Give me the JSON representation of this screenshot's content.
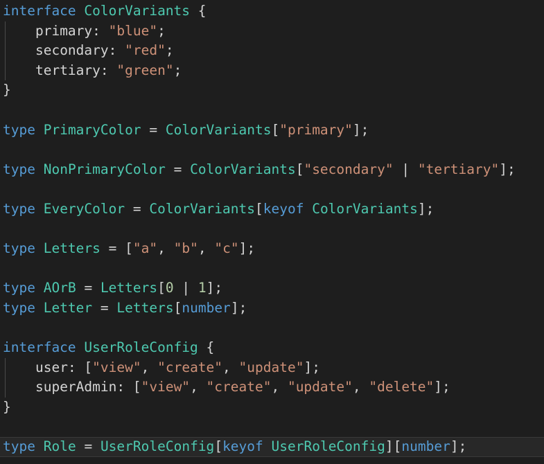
{
  "editor": {
    "language": "typescript",
    "background_color": "#1e1e1e",
    "current_line_background": "#282828",
    "current_line_border": "#3a3a3a",
    "indent_guide_color": "#4a4a4a",
    "font_size_px": 19.5,
    "line_height_px": 28.6,
    "colors": {
      "keyword": "#569cd6",
      "type_name": "#4ec9b0",
      "string": "#ce9178",
      "property": "#d4d4d4",
      "punctuation": "#d4d4d4",
      "number": "#b5cea8",
      "foreground": "#d4d4d4"
    },
    "lines": [
      {
        "n": 1,
        "current": false,
        "guide": false,
        "tokens": [
          {
            "t": "interface",
            "c": "kw"
          },
          {
            "t": " ",
            "c": "pun"
          },
          {
            "t": "ColorVariants",
            "c": "typ"
          },
          {
            "t": " ",
            "c": "pun"
          },
          {
            "t": "{",
            "c": "pun"
          }
        ]
      },
      {
        "n": 2,
        "current": false,
        "guide": true,
        "tokens": [
          {
            "t": "    ",
            "c": "pun"
          },
          {
            "t": "primary",
            "c": "prop"
          },
          {
            "t": ": ",
            "c": "pun"
          },
          {
            "t": "\"blue\"",
            "c": "str"
          },
          {
            "t": ";",
            "c": "pun"
          }
        ]
      },
      {
        "n": 3,
        "current": false,
        "guide": true,
        "tokens": [
          {
            "t": "    ",
            "c": "pun"
          },
          {
            "t": "secondary",
            "c": "prop"
          },
          {
            "t": ": ",
            "c": "pun"
          },
          {
            "t": "\"red\"",
            "c": "str"
          },
          {
            "t": ";",
            "c": "pun"
          }
        ]
      },
      {
        "n": 4,
        "current": false,
        "guide": true,
        "tokens": [
          {
            "t": "    ",
            "c": "pun"
          },
          {
            "t": "tertiary",
            "c": "prop"
          },
          {
            "t": ": ",
            "c": "pun"
          },
          {
            "t": "\"green\"",
            "c": "str"
          },
          {
            "t": ";",
            "c": "pun"
          }
        ]
      },
      {
        "n": 5,
        "current": false,
        "guide": false,
        "tokens": [
          {
            "t": "}",
            "c": "pun"
          }
        ]
      },
      {
        "n": 6,
        "current": false,
        "guide": false,
        "tokens": []
      },
      {
        "n": 7,
        "current": false,
        "guide": false,
        "tokens": [
          {
            "t": "type",
            "c": "kw"
          },
          {
            "t": " ",
            "c": "pun"
          },
          {
            "t": "PrimaryColor",
            "c": "typ"
          },
          {
            "t": " ",
            "c": "pun"
          },
          {
            "t": "=",
            "c": "op"
          },
          {
            "t": " ",
            "c": "pun"
          },
          {
            "t": "ColorVariants",
            "c": "typ"
          },
          {
            "t": "[",
            "c": "pun"
          },
          {
            "t": "\"primary\"",
            "c": "str"
          },
          {
            "t": "]",
            "c": "pun"
          },
          {
            "t": ";",
            "c": "pun"
          }
        ]
      },
      {
        "n": 8,
        "current": false,
        "guide": false,
        "tokens": []
      },
      {
        "n": 9,
        "current": false,
        "guide": false,
        "tokens": [
          {
            "t": "type",
            "c": "kw"
          },
          {
            "t": " ",
            "c": "pun"
          },
          {
            "t": "NonPrimaryColor",
            "c": "typ"
          },
          {
            "t": " ",
            "c": "pun"
          },
          {
            "t": "=",
            "c": "op"
          },
          {
            "t": " ",
            "c": "pun"
          },
          {
            "t": "ColorVariants",
            "c": "typ"
          },
          {
            "t": "[",
            "c": "pun"
          },
          {
            "t": "\"secondary\"",
            "c": "str"
          },
          {
            "t": " ",
            "c": "pun"
          },
          {
            "t": "|",
            "c": "op"
          },
          {
            "t": " ",
            "c": "pun"
          },
          {
            "t": "\"tertiary\"",
            "c": "str"
          },
          {
            "t": "]",
            "c": "pun"
          },
          {
            "t": ";",
            "c": "pun"
          }
        ]
      },
      {
        "n": 10,
        "current": false,
        "guide": false,
        "tokens": []
      },
      {
        "n": 11,
        "current": false,
        "guide": false,
        "tokens": [
          {
            "t": "type",
            "c": "kw"
          },
          {
            "t": " ",
            "c": "pun"
          },
          {
            "t": "EveryColor",
            "c": "typ"
          },
          {
            "t": " ",
            "c": "pun"
          },
          {
            "t": "=",
            "c": "op"
          },
          {
            "t": " ",
            "c": "pun"
          },
          {
            "t": "ColorVariants",
            "c": "typ"
          },
          {
            "t": "[",
            "c": "pun"
          },
          {
            "t": "keyof",
            "c": "kw"
          },
          {
            "t": " ",
            "c": "pun"
          },
          {
            "t": "ColorVariants",
            "c": "typ"
          },
          {
            "t": "]",
            "c": "pun"
          },
          {
            "t": ";",
            "c": "pun"
          }
        ]
      },
      {
        "n": 12,
        "current": false,
        "guide": false,
        "tokens": []
      },
      {
        "n": 13,
        "current": false,
        "guide": false,
        "tokens": [
          {
            "t": "type",
            "c": "kw"
          },
          {
            "t": " ",
            "c": "pun"
          },
          {
            "t": "Letters",
            "c": "typ"
          },
          {
            "t": " ",
            "c": "pun"
          },
          {
            "t": "=",
            "c": "op"
          },
          {
            "t": " ",
            "c": "pun"
          },
          {
            "t": "[",
            "c": "pun"
          },
          {
            "t": "\"a\"",
            "c": "str"
          },
          {
            "t": ", ",
            "c": "pun"
          },
          {
            "t": "\"b\"",
            "c": "str"
          },
          {
            "t": ", ",
            "c": "pun"
          },
          {
            "t": "\"c\"",
            "c": "str"
          },
          {
            "t": "]",
            "c": "pun"
          },
          {
            "t": ";",
            "c": "pun"
          }
        ]
      },
      {
        "n": 14,
        "current": false,
        "guide": false,
        "tokens": []
      },
      {
        "n": 15,
        "current": false,
        "guide": false,
        "tokens": [
          {
            "t": "type",
            "c": "kw"
          },
          {
            "t": " ",
            "c": "pun"
          },
          {
            "t": "AOrB",
            "c": "typ"
          },
          {
            "t": " ",
            "c": "pun"
          },
          {
            "t": "=",
            "c": "op"
          },
          {
            "t": " ",
            "c": "pun"
          },
          {
            "t": "Letters",
            "c": "typ"
          },
          {
            "t": "[",
            "c": "pun"
          },
          {
            "t": "0",
            "c": "num"
          },
          {
            "t": " ",
            "c": "pun"
          },
          {
            "t": "|",
            "c": "op"
          },
          {
            "t": " ",
            "c": "pun"
          },
          {
            "t": "1",
            "c": "num"
          },
          {
            "t": "]",
            "c": "pun"
          },
          {
            "t": ";",
            "c": "pun"
          }
        ]
      },
      {
        "n": 16,
        "current": false,
        "guide": false,
        "tokens": [
          {
            "t": "type",
            "c": "kw"
          },
          {
            "t": " ",
            "c": "pun"
          },
          {
            "t": "Letter",
            "c": "typ"
          },
          {
            "t": " ",
            "c": "pun"
          },
          {
            "t": "=",
            "c": "op"
          },
          {
            "t": " ",
            "c": "pun"
          },
          {
            "t": "Letters",
            "c": "typ"
          },
          {
            "t": "[",
            "c": "pun"
          },
          {
            "t": "number",
            "c": "kw"
          },
          {
            "t": "]",
            "c": "pun"
          },
          {
            "t": ";",
            "c": "pun"
          }
        ]
      },
      {
        "n": 17,
        "current": false,
        "guide": false,
        "tokens": []
      },
      {
        "n": 18,
        "current": false,
        "guide": false,
        "tokens": [
          {
            "t": "interface",
            "c": "kw"
          },
          {
            "t": " ",
            "c": "pun"
          },
          {
            "t": "UserRoleConfig",
            "c": "typ"
          },
          {
            "t": " ",
            "c": "pun"
          },
          {
            "t": "{",
            "c": "pun"
          }
        ]
      },
      {
        "n": 19,
        "current": false,
        "guide": true,
        "tokens": [
          {
            "t": "    ",
            "c": "pun"
          },
          {
            "t": "user",
            "c": "prop"
          },
          {
            "t": ": ",
            "c": "pun"
          },
          {
            "t": "[",
            "c": "pun"
          },
          {
            "t": "\"view\"",
            "c": "str"
          },
          {
            "t": ", ",
            "c": "pun"
          },
          {
            "t": "\"create\"",
            "c": "str"
          },
          {
            "t": ", ",
            "c": "pun"
          },
          {
            "t": "\"update\"",
            "c": "str"
          },
          {
            "t": "]",
            "c": "pun"
          },
          {
            "t": ";",
            "c": "pun"
          }
        ]
      },
      {
        "n": 20,
        "current": false,
        "guide": true,
        "tokens": [
          {
            "t": "    ",
            "c": "pun"
          },
          {
            "t": "superAdmin",
            "c": "prop"
          },
          {
            "t": ": ",
            "c": "pun"
          },
          {
            "t": "[",
            "c": "pun"
          },
          {
            "t": "\"view\"",
            "c": "str"
          },
          {
            "t": ", ",
            "c": "pun"
          },
          {
            "t": "\"create\"",
            "c": "str"
          },
          {
            "t": ", ",
            "c": "pun"
          },
          {
            "t": "\"update\"",
            "c": "str"
          },
          {
            "t": ", ",
            "c": "pun"
          },
          {
            "t": "\"delete\"",
            "c": "str"
          },
          {
            "t": "]",
            "c": "pun"
          },
          {
            "t": ";",
            "c": "pun"
          }
        ]
      },
      {
        "n": 21,
        "current": false,
        "guide": false,
        "tokens": [
          {
            "t": "}",
            "c": "pun"
          }
        ]
      },
      {
        "n": 22,
        "current": false,
        "guide": false,
        "tokens": []
      },
      {
        "n": 23,
        "current": true,
        "guide": false,
        "tokens": [
          {
            "t": "type",
            "c": "kw"
          },
          {
            "t": " ",
            "c": "pun"
          },
          {
            "t": "Role",
            "c": "typ"
          },
          {
            "t": " ",
            "c": "pun"
          },
          {
            "t": "=",
            "c": "op"
          },
          {
            "t": " ",
            "c": "pun"
          },
          {
            "t": "UserRoleConfig",
            "c": "typ"
          },
          {
            "t": "[",
            "c": "pun"
          },
          {
            "t": "keyof",
            "c": "kw"
          },
          {
            "t": " ",
            "c": "pun"
          },
          {
            "t": "UserRoleConfig",
            "c": "typ"
          },
          {
            "t": "]",
            "c": "pun"
          },
          {
            "t": "[",
            "c": "pun"
          },
          {
            "t": "number",
            "c": "kw"
          },
          {
            "t": "]",
            "c": "pun"
          },
          {
            "t": ";",
            "c": "pun"
          }
        ]
      }
    ]
  }
}
